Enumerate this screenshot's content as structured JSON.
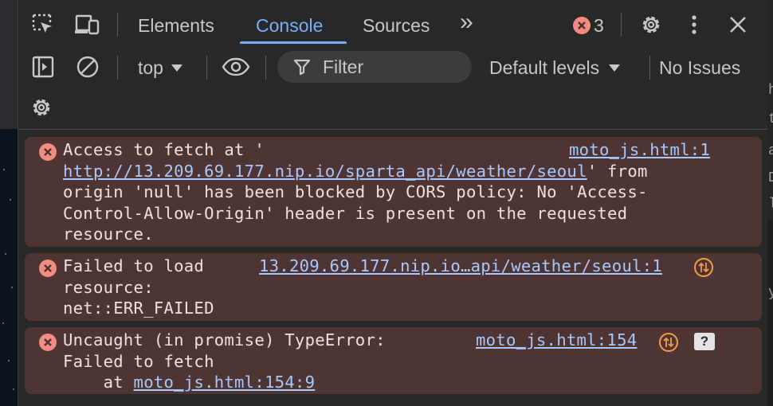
{
  "tabs": {
    "elements": "Elements",
    "console": "Console",
    "sources": "Sources",
    "more": "»"
  },
  "error_count": "3",
  "toolbar": {
    "context": "top",
    "filter_placeholder": "Filter",
    "levels": "Default levels",
    "issues": "No Issues"
  },
  "messages": [
    {
      "lines": [
        "Access to fetch at '",
        "' from",
        "origin 'null' has been blocked by CORS policy: No 'Access-",
        "Control-Allow-Origin' header is present on the requested",
        "resource."
      ],
      "url": "http://13.209.69.177.nip.io/sparta_api/weather/seoul",
      "source": "moto_js.html:1"
    },
    {
      "lines": [
        "Failed to load",
        "resource:",
        "net::ERR_FAILED"
      ],
      "source": "13.209.69.177.nip.io…api/weather/seoul:1"
    },
    {
      "lines": [
        "Uncaught (in promise) TypeError:",
        "Failed to fetch",
        "    at "
      ],
      "stack_link": "moto_js.html:154:9",
      "source": "moto_js.html:154"
    }
  ],
  "right_edge_chars": [
    "h",
    "t",
    "a",
    "D",
    "l",
    "y"
  ],
  "colors": {
    "accent": "#7cacf8",
    "error_bg": "#4e3534",
    "error_icon": "#f28b82",
    "link": "#a8c7fa",
    "network_badge": "#f29d49"
  },
  "icons": [
    "inspect-element-icon",
    "device-toolbar-icon",
    "error-icon",
    "settings-gear-icon",
    "more-vertical-icon",
    "close-icon",
    "sidebar-toggle-icon",
    "clear-console-icon",
    "eye-icon",
    "filter-icon",
    "console-settings-gear-icon",
    "network-request-icon",
    "help-icon"
  ]
}
